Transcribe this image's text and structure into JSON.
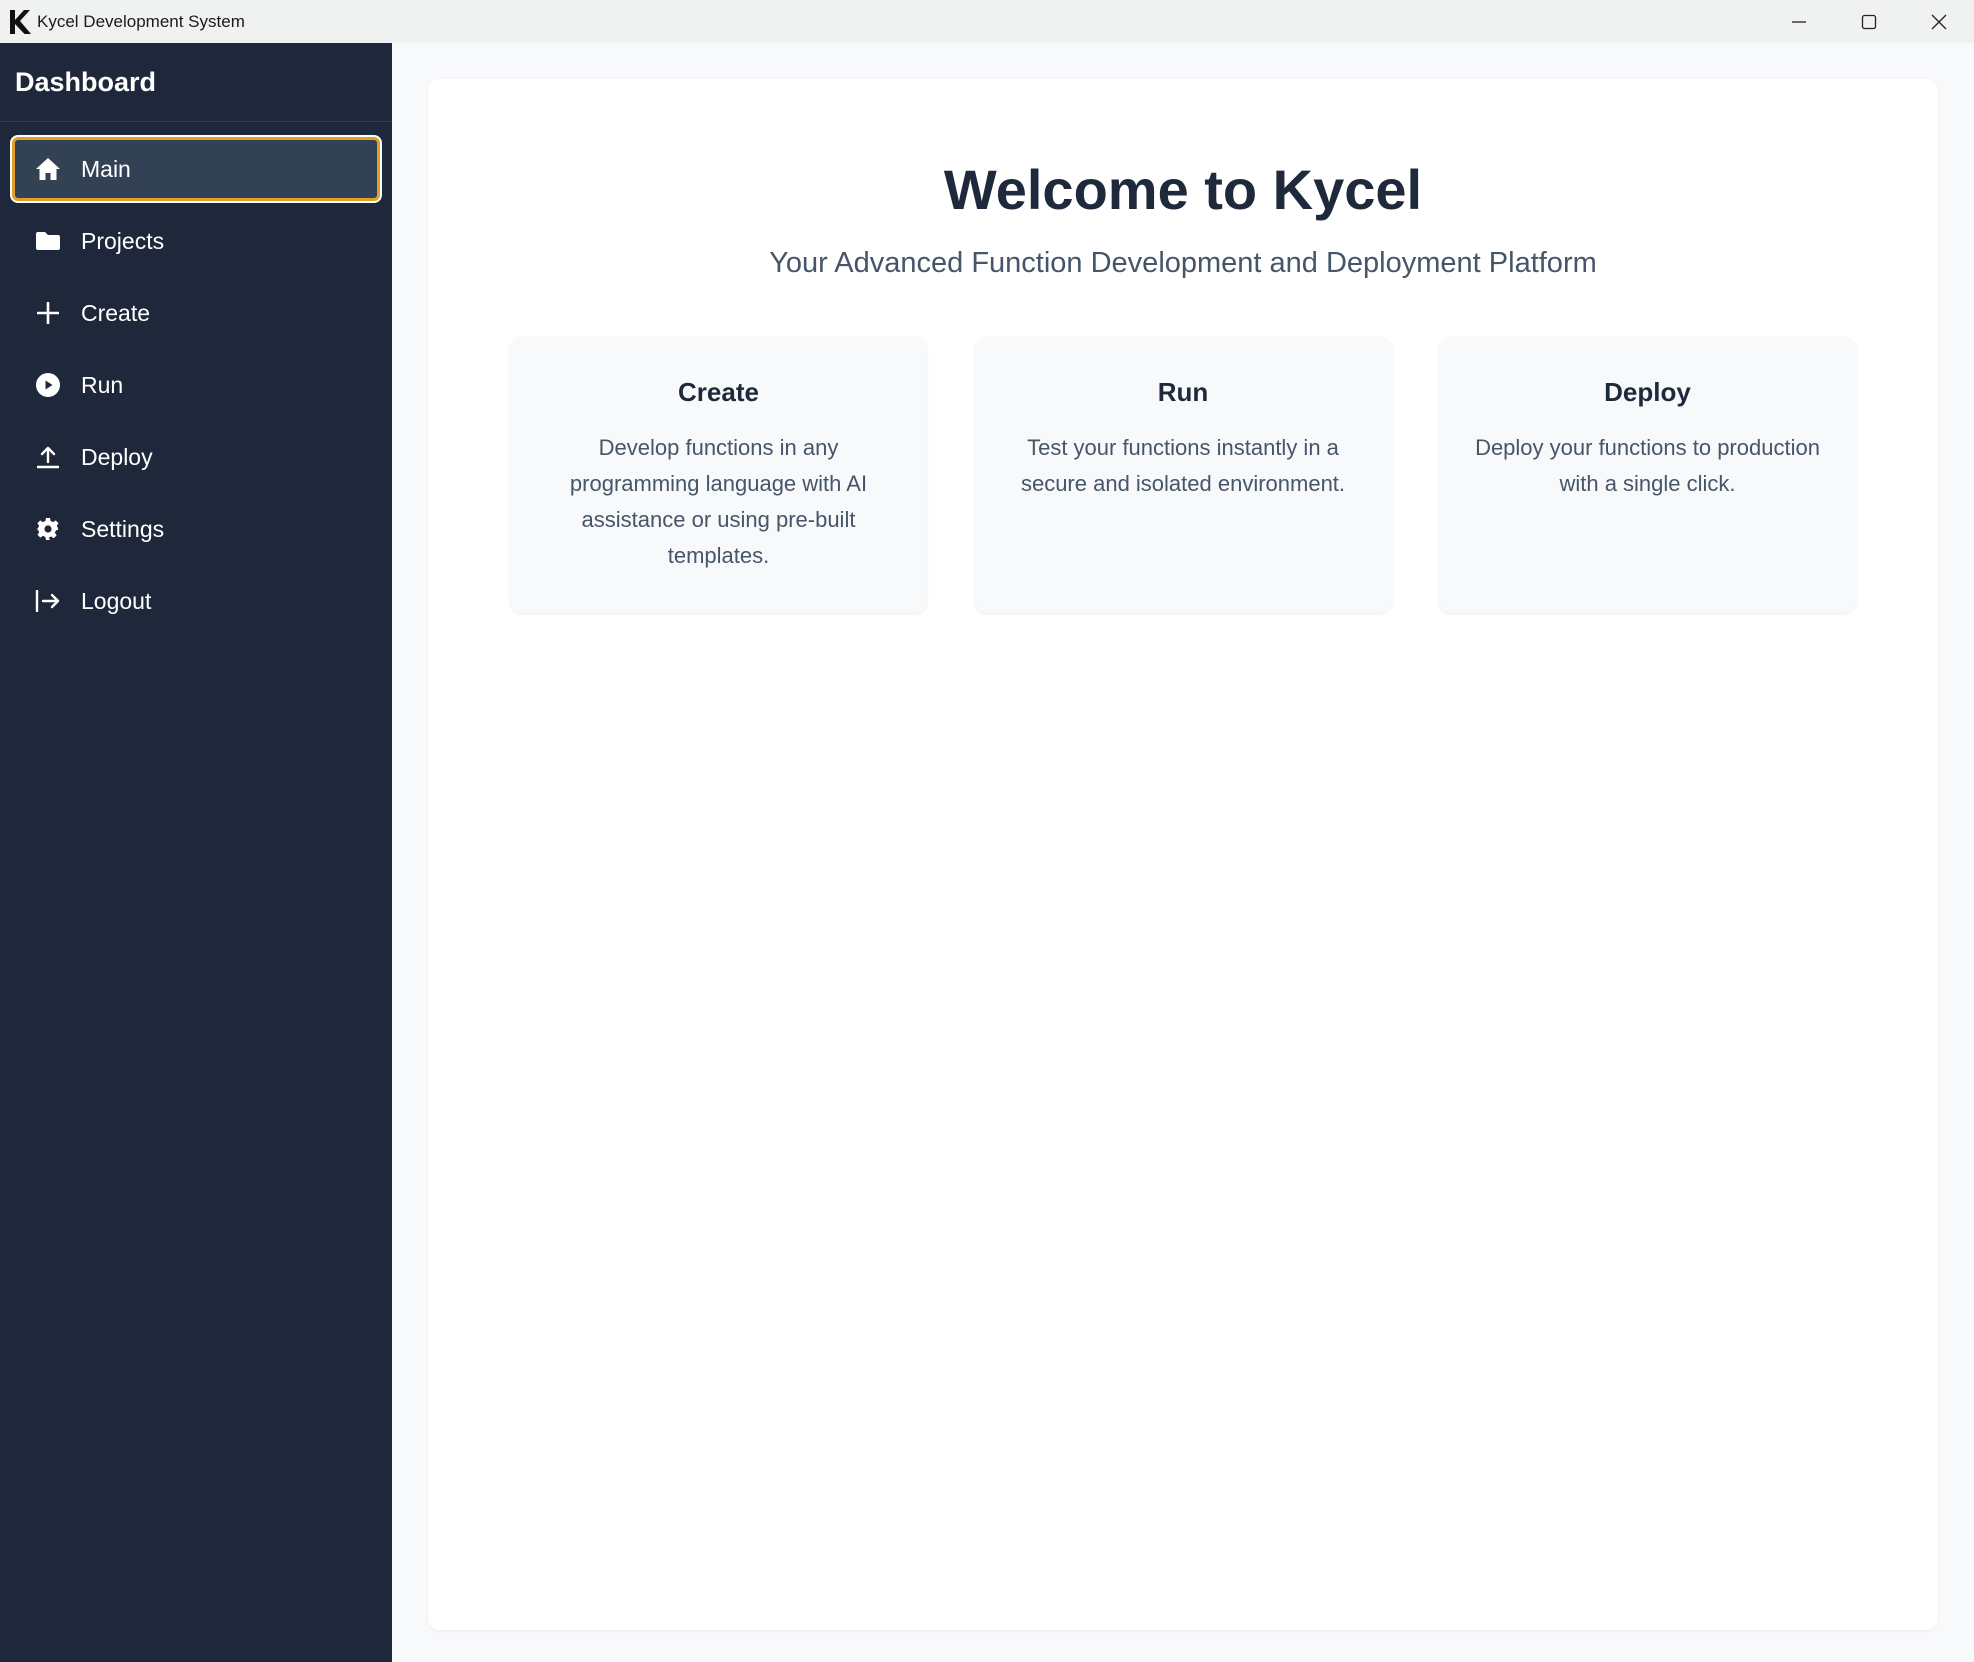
{
  "window": {
    "title": "Kycel Development System",
    "logo_icon": "kycel-k-logo",
    "controls": [
      {
        "name": "minimize",
        "icon": "minimize-icon"
      },
      {
        "name": "maximize",
        "icon": "maximize-icon"
      },
      {
        "name": "close",
        "icon": "close-icon"
      }
    ]
  },
  "sidebar": {
    "title": "Dashboard",
    "items": [
      {
        "label": "Main",
        "icon": "home-icon",
        "active": true
      },
      {
        "label": "Projects",
        "icon": "folder-icon",
        "active": false
      },
      {
        "label": "Create",
        "icon": "plus-icon",
        "active": false
      },
      {
        "label": "Run",
        "icon": "play-circle-icon",
        "active": false
      },
      {
        "label": "Deploy",
        "icon": "upload-icon",
        "active": false
      },
      {
        "label": "Settings",
        "icon": "gear-icon",
        "active": false
      },
      {
        "label": "Logout",
        "icon": "logout-icon",
        "active": false
      }
    ]
  },
  "main": {
    "title": "Welcome to Kycel",
    "subtitle": "Your Advanced Function Development and Deployment Platform",
    "cards": [
      {
        "title": "Create",
        "description": "Develop functions in any programming language with AI assistance or using pre-built templates."
      },
      {
        "title": "Run",
        "description": "Test your functions instantly in a secure and isolated environment."
      },
      {
        "title": "Deploy",
        "description": "Deploy your functions to production with a single click."
      }
    ]
  },
  "colors": {
    "sidebar_bg": "#1f283b",
    "active_item_bg": "#334155",
    "active_item_border": "#e0a02a",
    "heading_text": "#1e293b",
    "body_text": "#475569"
  }
}
